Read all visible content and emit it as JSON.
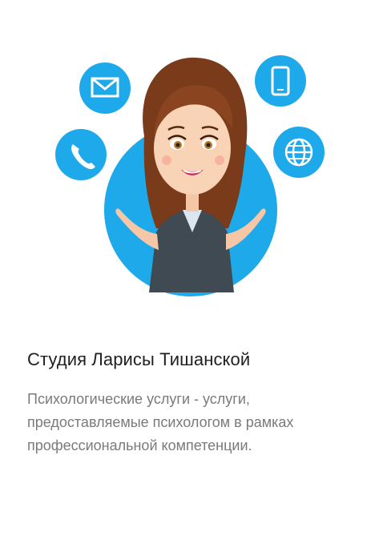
{
  "card": {
    "title": "Студия Ларисы Тишанской",
    "description": "Психологические услуги - услуги, предоставляемые психологом в рамках профессиональной компетенции."
  },
  "illustration": {
    "icons": [
      "mail-icon",
      "phone-icon",
      "mobile-device-icon",
      "globe-icon"
    ],
    "accent_color": "#1ea9ea",
    "jacket_color": "#3f4a52",
    "hair_color": "#7a3b1a"
  }
}
